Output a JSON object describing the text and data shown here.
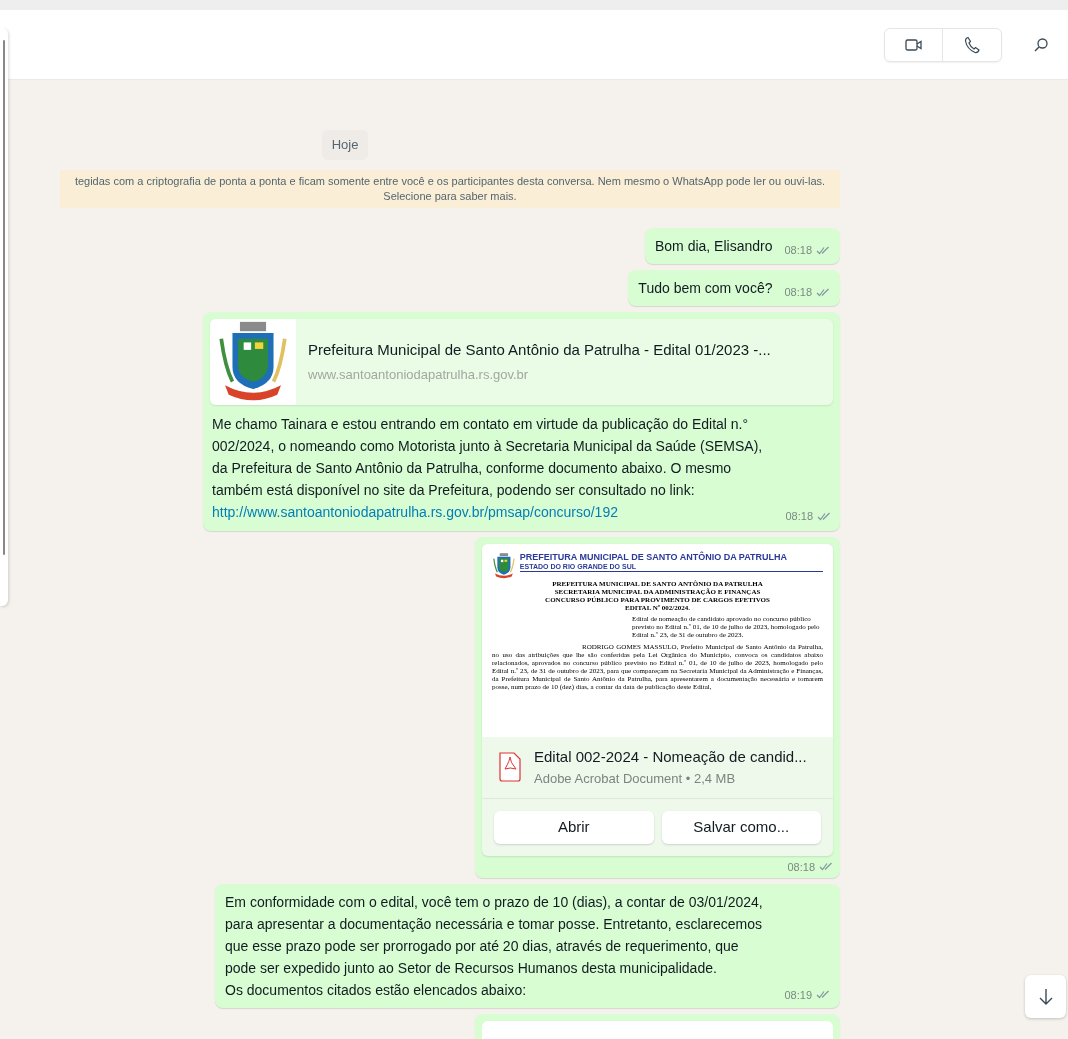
{
  "date_separator": "Hoje",
  "encryption_notice": "tegidas com a criptografia de ponta a ponta e ficam somente entre você e os participantes desta conversa. Nem mesmo o WhatsApp pode ler ou ouvi-las. Selecione para saber mais.",
  "messages": [
    {
      "kind": "text",
      "text": "Bom dia, Elisandro",
      "time": "08:18"
    },
    {
      "kind": "text",
      "text": "Tudo bem com você?",
      "time": "08:18"
    },
    {
      "kind": "link",
      "preview": {
        "title": "Prefeitura Municipal de Santo Antônio da Patrulha - Edital 01/2023 -...",
        "domain": "www.santoantoniodapatrulha.rs.gov.br"
      },
      "text": "Me chamo Tainara e estou entrando em contato em virtude da publicação do Edital n.° 002/2024, o nomeando como Motorista junto à Secretaria Municipal da Saúde (SEMSA), da Prefeitura de Santo Antônio da Patrulha, conforme documento abaixo. O mesmo também está disponível no site da Prefeitura, podendo ser consultado no link:",
      "link": "http://www.santoantoniodapatrulha.rs.gov.br/pmsap/concurso/192",
      "time": "08:18"
    },
    {
      "kind": "document",
      "preview": {
        "header_title": "PREFEITURA MUNICIPAL DE SANTO ANTÔNIO DA PATRULHA",
        "header_subtitle": "ESTADO DO RIO GRANDE DO SUL",
        "heading_lines": [
          "PREFEITURA MUNICIPAL DE SANTO ANTÔNIO DA PATRULHA",
          "SECRETARIA MUNICIPAL DA ADMINISTRAÇÃO E FINANÇAS",
          "CONCURSO PÚBLICO PARA PROVIMENTO DE CARGOS EFETIVOS",
          "EDITAL Nº 002/2024."
        ],
        "summary": "Edital de nomeação de candidato aprovado no concurso público previsto no Edital n.º 01, de 10 de julho de 2023, homologado pelo Edital n.º 23, de 31 de outubro de 2023.",
        "body": "RODRIGO GOMES MASSULO, Prefeito Municipal de Santo Antônio da Patrulha, no uso das atribuições que lhe são conferidas pela Lei Orgânica do Município, convoca os candidatos abaixo relacionados, aprovados no concurso público previsto no Edital n.º 01, de 10 de julho de 2023, homologado pelo Edital n.º 23, de 31 de outubro de 2023, para que compareçam na Secretaria Municipal da Administração e Finanças, da Prefeitura Municipal de Santo Antônio da Patrulha, para apresentarem a documentação necessária e tomarem posse, num prazo de 10 (dez) dias, a contar da data de publicação deste Edital,"
      },
      "file_name": "Edital 002-2024 - Nomeação de candid...",
      "file_info": "Adobe Acrobat Document • 2,4 MB",
      "buttons": [
        "Abrir",
        "Salvar como..."
      ],
      "time": "08:18"
    },
    {
      "kind": "text",
      "text": "Em conformidade com o edital, você tem o prazo de 10 (dias), a contar de 03/01/2024, para apresentar a documentação necessária e tomar posse. Entretanto, esclarecemos que esse prazo pode ser prorrogado por até 20 dias, através de requerimento, que pode ser expedido junto ao Setor de Recursos Humanos desta municipalidade.\nOs documentos citados estão elencados abaixo:",
      "time": "08:19"
    },
    {
      "kind": "cut_off"
    }
  ]
}
